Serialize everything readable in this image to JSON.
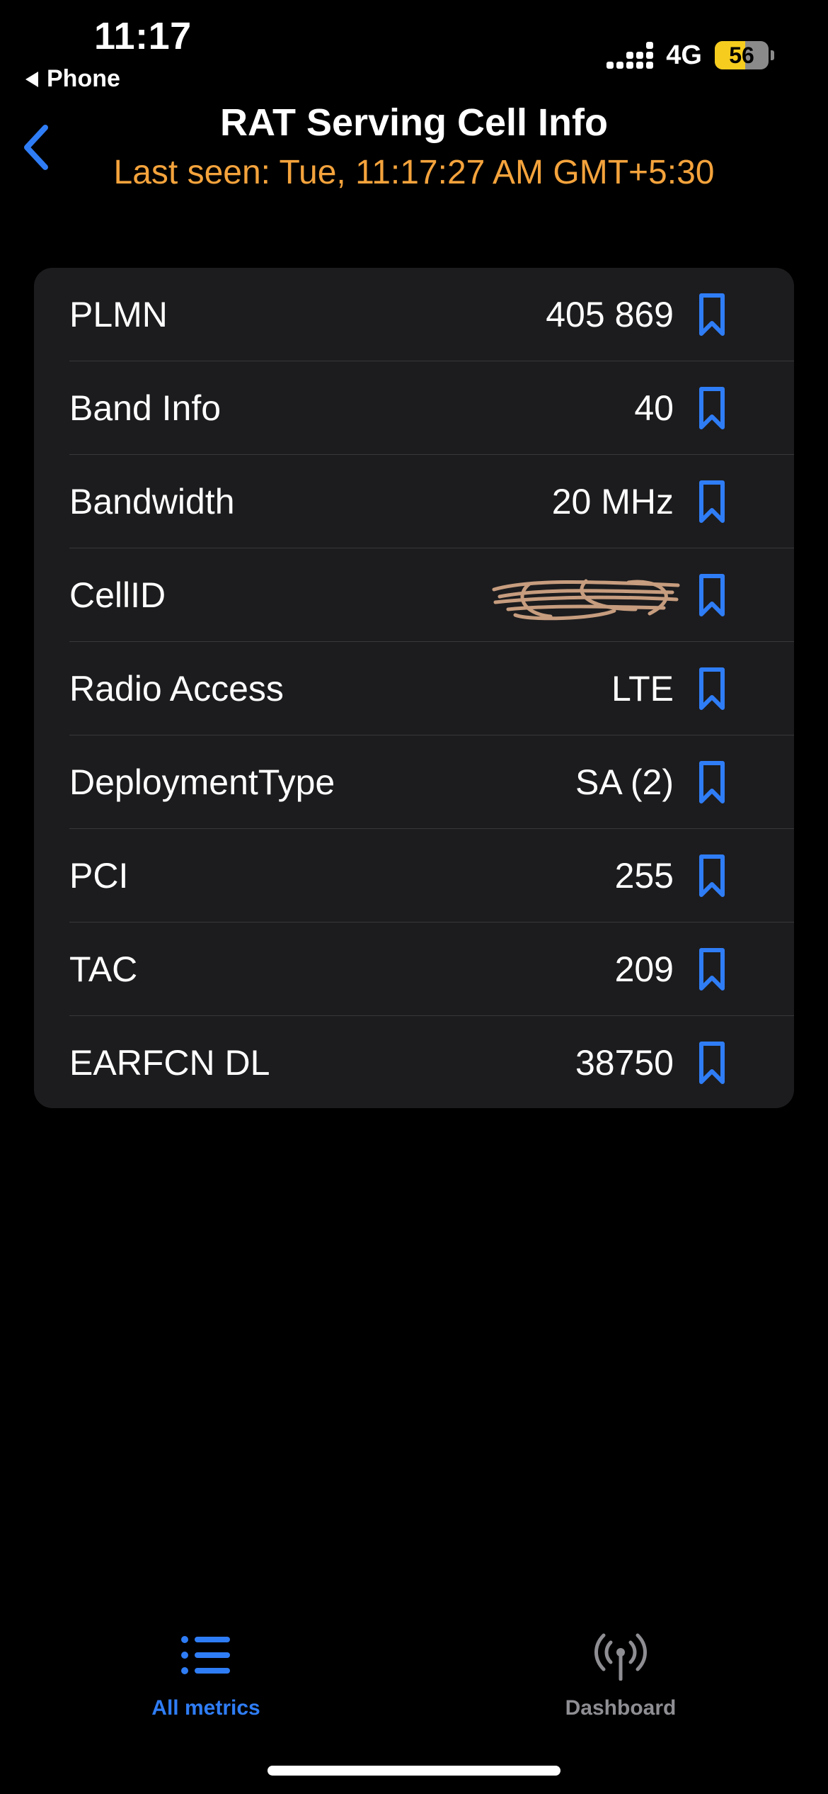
{
  "status_bar": {
    "time": "11:17",
    "back_app": "Phone",
    "network": "4G",
    "battery": "56",
    "battery_level": 0.56
  },
  "nav": {
    "title": "RAT Serving Cell Info",
    "subtitle": "Last seen: Tue, 11:17:27 AM GMT+5:30"
  },
  "colors": {
    "accent": "#2f7df6",
    "subtitle": "#f4a33c",
    "card": "#1c1c1e",
    "background": "#000000"
  },
  "rows": [
    {
      "label": "PLMN",
      "value": "405 869"
    },
    {
      "label": "Band Info",
      "value": "40"
    },
    {
      "label": "Bandwidth",
      "value": "20 MHz"
    },
    {
      "label": "CellID",
      "value": "",
      "redacted": true
    },
    {
      "label": "Radio Access",
      "value": "LTE"
    },
    {
      "label": "DeploymentType",
      "value": "SA (2)"
    },
    {
      "label": "PCI",
      "value": "255"
    },
    {
      "label": "TAC",
      "value": "209"
    },
    {
      "label": "EARFCN DL",
      "value": "38750"
    }
  ],
  "tabs": [
    {
      "label": "All metrics",
      "icon": "list-icon",
      "active": true
    },
    {
      "label": "Dashboard",
      "icon": "antenna-icon",
      "active": false
    }
  ]
}
